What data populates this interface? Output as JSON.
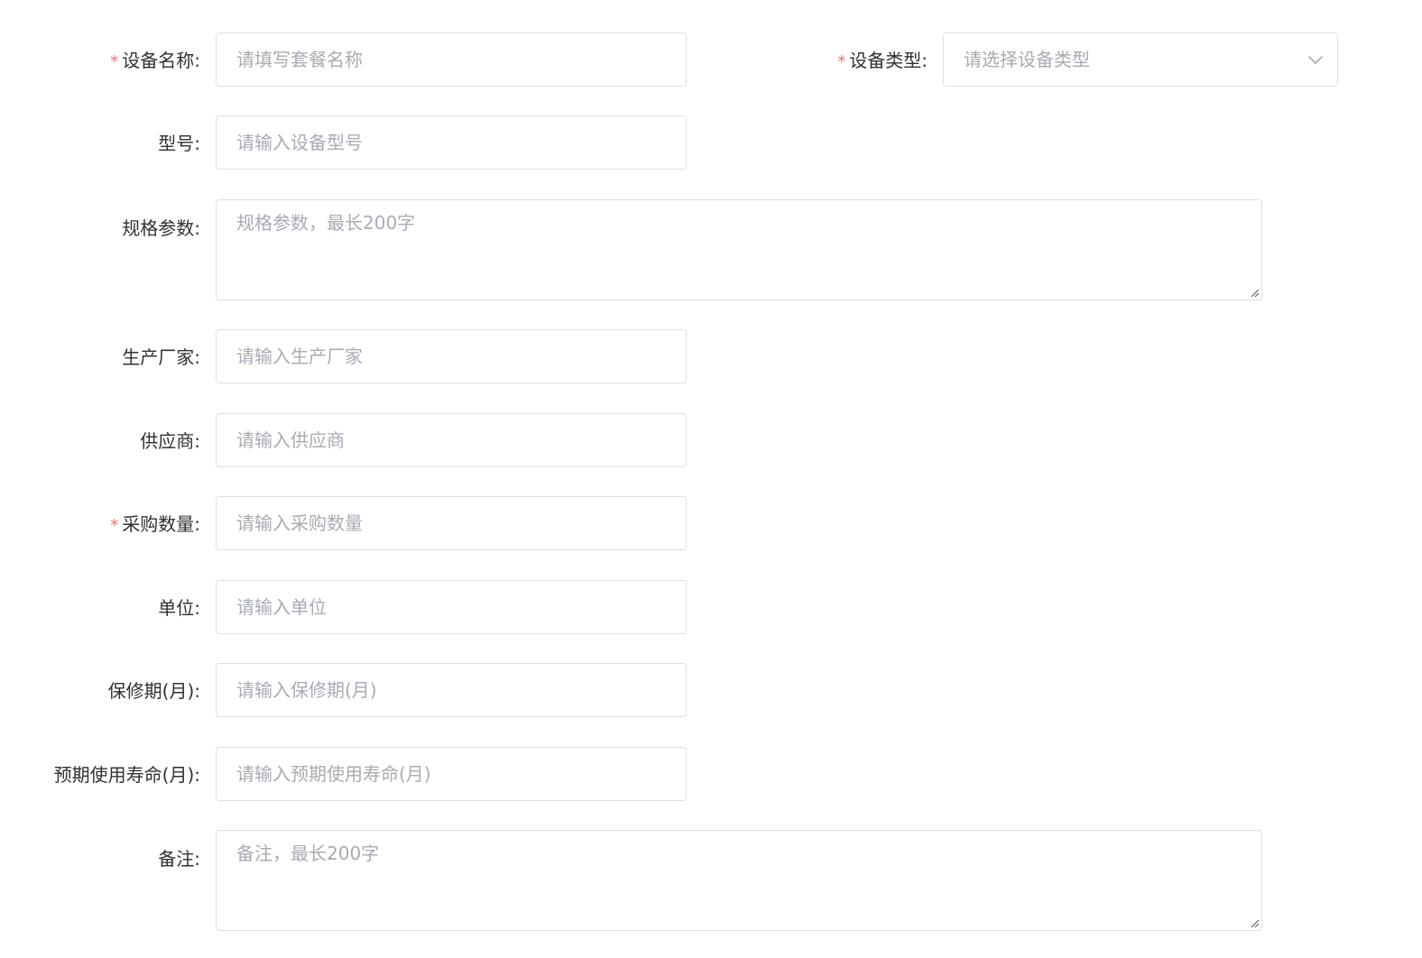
{
  "form": {
    "device_name": {
      "label": "设备名称:",
      "required": true,
      "placeholder": "请填写套餐名称"
    },
    "device_type": {
      "label": "设备类型:",
      "required": true,
      "placeholder": "请选择设备类型",
      "icon": "chevron-down-icon"
    },
    "model": {
      "label": "型号:",
      "required": false,
      "placeholder": "请输入设备型号"
    },
    "specs": {
      "label": "规格参数:",
      "required": false,
      "placeholder": "规格参数，最长200字"
    },
    "manufacturer": {
      "label": "生产厂家:",
      "required": false,
      "placeholder": "请输入生产厂家"
    },
    "supplier": {
      "label": "供应商:",
      "required": false,
      "placeholder": "请输入供应商"
    },
    "purchase_quantity": {
      "label": "采购数量:",
      "required": true,
      "placeholder": "请输入采购数量"
    },
    "unit": {
      "label": "单位:",
      "required": false,
      "placeholder": "请输入单位"
    },
    "warranty": {
      "label": "保修期(月):",
      "required": false,
      "placeholder": "请输入保修期(月)"
    },
    "lifespan": {
      "label": "预期使用寿命(月):",
      "required": false,
      "placeholder": "请输入预期使用寿命(月)"
    },
    "remarks": {
      "label": "备注:",
      "required": false,
      "placeholder": "备注，最长200字"
    }
  },
  "required_mark": "*",
  "colors": {
    "required": "#f56c6c",
    "border": "#dcdfe6",
    "placeholder": "#a8abb2",
    "label": "#303133"
  }
}
